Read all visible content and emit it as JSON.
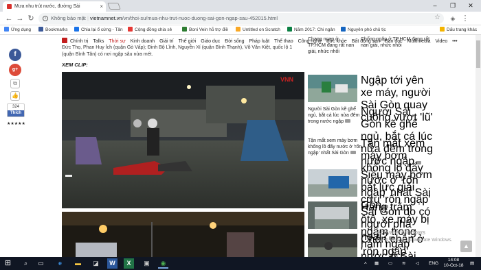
{
  "browser": {
    "tab_title": "Mưa nhu trút nước, đường Sài",
    "tab_close": "×",
    "window": {
      "minimize": "–",
      "maximize": "❐",
      "close": "✕"
    },
    "address": {
      "insecure_label": "Không bảo mật",
      "domain": "vietnamnet.vn",
      "path": "/vn/thoi-su/mua-nhu-trut-nuoc-duong-sai-gon-ngap-sau-452015.html"
    },
    "bookmarks": [
      {
        "label": "Ứng dụng",
        "color": "#4285f4"
      },
      {
        "label": "Bookmarks",
        "color": "#3b5998"
      },
      {
        "label": "Chia lại ổ cứng - Tân",
        "color": "#1a73e8"
      },
      {
        "label": "Cộng đồng chia sẻ",
        "color": "#e53935"
      },
      {
        "label": "Boni Vein hỗ trợ điề",
        "color": "#2e7d32"
      },
      {
        "label": "Untitled on Scratch",
        "color": "#f9a825"
      },
      {
        "label": "Năm 2017: Chi ngân",
        "color": "#0b8043"
      },
      {
        "label": "Nguyên phó chủ tịc",
        "color": "#1565c0"
      },
      {
        "label": "Dấu trang khác",
        "color": "#f4b400"
      }
    ]
  },
  "nav": {
    "items": [
      "Chính trị",
      "Talks",
      "Thời sự",
      "Kinh doanh",
      "Giải trí",
      "Thế giới",
      "Giáo dục",
      "Đời sống",
      "Pháp luật",
      "Thể thao",
      "Công nghệ",
      "Sức khỏe",
      "Bất động sản",
      "Bạn đọc",
      "Multimedia",
      "Video",
      "•••"
    ],
    "current": "Thời sự"
  },
  "share": {
    "facebook_glyph": "f",
    "google_glyph": "g+",
    "like_count": "324",
    "like_label": "Thích",
    "rating": "★★★★★"
  },
  "article": {
    "intro": "Đức Thọ, Phan Huy Ích (quận Gò Vấp); Đinh Bộ Lĩnh, Nguyễn Xí (quận Bình Thạnh), Võ Văn Kiệt, quốc lộ 1 (quận Bình Tân) có nơi ngập sâu nửa mét.",
    "clip_label": "XEM CLIP:",
    "video_logo": "VNN"
  },
  "sidebar": {
    "top_left": "Chang ngap ở TP.HCM đang rất nan giải, nhức nhối",
    "top_right": "Chống ngập ở TP.HCM đang rất nan giải, nhức nhối",
    "items": [
      {
        "text": "Ngập tới yên xe máy, người Sài Gòn quay cuồng vượt 'lũ'"
      },
      {
        "alt": "Người Sài Gòn kẽ ghế ngủ, bắt cá lúc nửa đêm trong nước ngập",
        "text": "Người Sài Gòn kẽ ghế ngủ, bắt cá lúc nửa đêm trong nước ngập"
      },
      {
        "alt": "Tận mắt xem máy bơm khổng lồ đẩy nước ở 'rốn ngập' nhất Sài Gòn",
        "text": "Tận mắt xem máy bơm khổng lồ đẩy nước ở 'rốn ngập' nhất Sài Gòn"
      },
      {
        "text": "Siêu máy bơm bắt lực giải cứu 'rốn ngập' Sài Gòn do có người phá hoại?"
      },
      {
        "text": "Hàng trăm ôtô, xe máy bị ngâm trong hầm ngập nước ở Sài Gòn"
      },
      {
        "text": "Chôn chân ở 'rốn ngập' vùng ven Sài Gòn"
      }
    ]
  },
  "overlay": {
    "activate_title": "Activate Windows",
    "activate_sub": "Go to Settings to activate Windows."
  },
  "taskbar": {
    "lang": "ENG",
    "time": "14:08",
    "date": "10-Oct-18",
    "start_glyph": "⊞"
  }
}
